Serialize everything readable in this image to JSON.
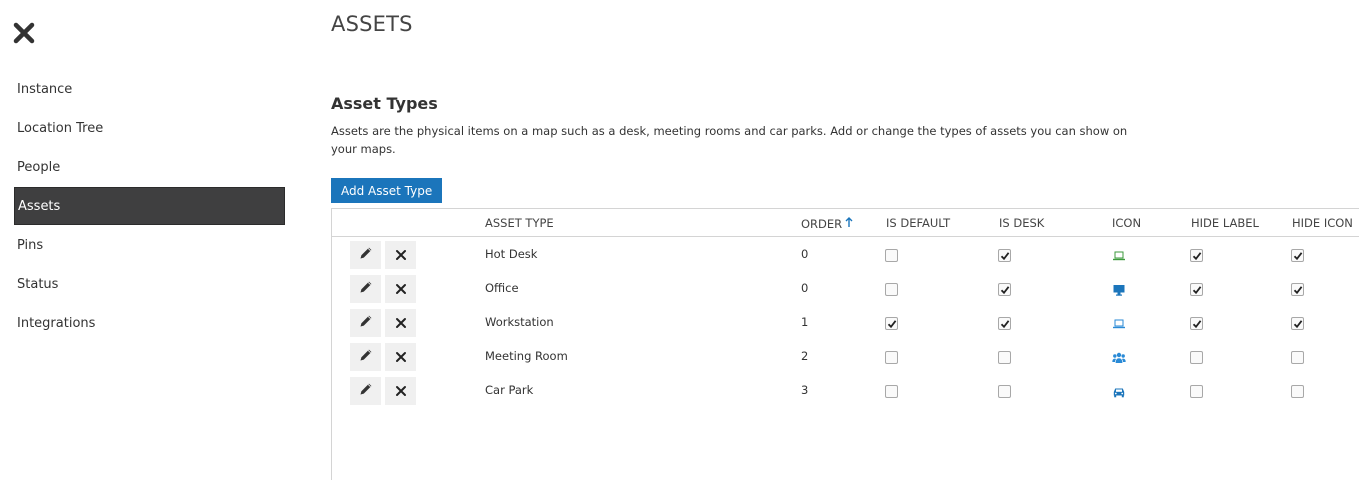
{
  "sidebar": {
    "items": [
      {
        "label": "Instance",
        "active": false
      },
      {
        "label": "Location Tree",
        "active": false
      },
      {
        "label": "People",
        "active": false
      },
      {
        "label": "Assets",
        "active": true
      },
      {
        "label": "Pins",
        "active": false
      },
      {
        "label": "Status",
        "active": false
      },
      {
        "label": "Integrations",
        "active": false
      }
    ]
  },
  "page": {
    "title": "ASSETS",
    "section_title": "Asset Types",
    "description": "Assets are the physical items on a map such as a desk, meeting rooms and car parks. Add or change the types of assets you can show on your maps.",
    "add_button_label": "Add Asset Type"
  },
  "table": {
    "headers": {
      "asset_type": "ASSET TYPE",
      "order": "ORDER",
      "is_default": "IS DEFAULT",
      "is_desk": "IS DESK",
      "icon": "ICON",
      "hide_label": "HIDE LABEL",
      "hide_icon": "HIDE ICON"
    },
    "sort": {
      "column": "order",
      "direction": "ascending"
    },
    "rows": [
      {
        "name": "Hot Desk",
        "order": "0",
        "is_default": false,
        "is_desk": true,
        "icon": "laptop-icon",
        "icon_color": "#3c9a3c",
        "hide_label": true,
        "hide_icon": true
      },
      {
        "name": "Office",
        "order": "0",
        "is_default": false,
        "is_desk": true,
        "icon": "desktop-icon",
        "icon_color": "#1b75bb",
        "hide_label": true,
        "hide_icon": true
      },
      {
        "name": "Workstation",
        "order": "1",
        "is_default": true,
        "is_desk": true,
        "icon": "laptop-icon",
        "icon_color": "#2a8ad6",
        "hide_label": true,
        "hide_icon": true
      },
      {
        "name": "Meeting Room",
        "order": "2",
        "is_default": false,
        "is_desk": false,
        "icon": "users-icon",
        "icon_color": "#2a8ad6",
        "hide_label": false,
        "hide_icon": false
      },
      {
        "name": "Car Park",
        "order": "3",
        "is_default": false,
        "is_desk": false,
        "icon": "car-icon",
        "icon_color": "#1b75bb",
        "hide_label": false,
        "hide_icon": false
      }
    ]
  },
  "colors": {
    "accent": "#1b75bb",
    "sidebar_active": "#3f3f40"
  }
}
